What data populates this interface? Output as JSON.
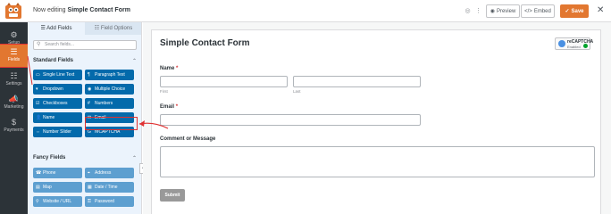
{
  "header": {
    "title_prefix": "Now editing",
    "form_name": "Simple Contact Form",
    "preview_label": "Preview",
    "embed_label": "Embed",
    "save_label": "Save",
    "close_glyph": "✕"
  },
  "left_nav": {
    "items": [
      {
        "label": "Setup",
        "icon": "gear-icon"
      },
      {
        "label": "Fields",
        "icon": "fields-icon"
      },
      {
        "label": "Settings",
        "icon": "sliders-icon"
      },
      {
        "label": "Marketing",
        "icon": "megaphone-icon"
      },
      {
        "label": "Payments",
        "icon": "dollar-icon"
      }
    ],
    "active": "Fields"
  },
  "panel": {
    "tabs": [
      {
        "label": "Add Fields",
        "active": true
      },
      {
        "label": "Field Options",
        "active": false
      }
    ],
    "search_placeholder": "Search fields...",
    "standard_heading": "Standard Fields",
    "standard_fields": [
      {
        "label": "Single Line Text",
        "icon": "▭"
      },
      {
        "label": "Paragraph Text",
        "icon": "¶"
      },
      {
        "label": "Dropdown",
        "icon": "▾"
      },
      {
        "label": "Multiple Choice",
        "icon": "◉"
      },
      {
        "label": "Checkboxes",
        "icon": "☑"
      },
      {
        "label": "Numbers",
        "icon": "#"
      },
      {
        "label": "Name",
        "icon": "👤"
      },
      {
        "label": "Email",
        "icon": "✉"
      },
      {
        "label": "Number Slider",
        "icon": "⇔"
      },
      {
        "label": "reCAPTCHA",
        "icon": "G"
      }
    ],
    "fancy_heading": "Fancy Fields",
    "fancy_fields": [
      {
        "label": "Phone",
        "icon": "☎"
      },
      {
        "label": "Address",
        "icon": "⌖"
      },
      {
        "label": "Map",
        "icon": "▤"
      },
      {
        "label": "Date / Time",
        "icon": "▦"
      },
      {
        "label": "Website / URL",
        "icon": "⚲"
      },
      {
        "label": "Password",
        "icon": "⚿"
      }
    ]
  },
  "form": {
    "title": "Simple Contact Form",
    "recaptcha_name": "reCAPTCHA",
    "recaptcha_status": "Enabled",
    "fields": {
      "name_label": "Name",
      "name_required": "*",
      "first_sublabel": "First",
      "last_sublabel": "Last",
      "email_label": "Email",
      "email_required": "*",
      "message_label": "Comment or Message"
    },
    "submit_label": "Submit"
  },
  "colors": {
    "accent": "#e27730",
    "field_button": "#036aab",
    "fancy_button": "#5d9fd0",
    "annotation": "#e03131"
  }
}
